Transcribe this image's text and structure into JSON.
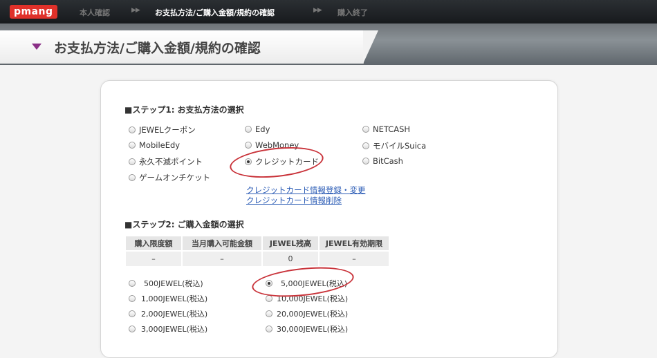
{
  "nav": {
    "logo": "pmang",
    "steps": [
      "本人確認",
      "お支払方法/ご購入金額/規約の確認",
      "購入終了"
    ],
    "arrow": "▶▶"
  },
  "header": {
    "title": "お支払方法/ご購入金額/規約の確認"
  },
  "step1": {
    "title": "■ステップ1: お支払方法の選択",
    "options": [
      {
        "label": "JEWELクーポン",
        "checked": false
      },
      {
        "label": "Edy",
        "checked": false
      },
      {
        "label": "NETCASH",
        "checked": false
      },
      {
        "label": "MobileEdy",
        "checked": false
      },
      {
        "label": "WebMoney",
        "checked": false
      },
      {
        "label": "モバイルSuica",
        "checked": false
      },
      {
        "label": "永久不滅ポイント",
        "checked": false
      },
      {
        "label": "クレジットカード",
        "checked": true
      },
      {
        "label": "BitCash",
        "checked": false
      },
      {
        "label": "ゲームオンチケット",
        "checked": false
      }
    ],
    "links": [
      "クレジットカード情報登録・変更",
      "クレジットカード情報削除"
    ]
  },
  "step2": {
    "title": "■ステップ2: ご購入金額の選択",
    "table": {
      "headers": [
        "購入限度額",
        "当月購入可能金額",
        "JEWEL残高",
        "JEWEL有効期限"
      ],
      "row": [
        "–",
        "–",
        "0",
        "–"
      ]
    },
    "amounts": [
      {
        "label": "500JEWEL(税込)",
        "checked": false
      },
      {
        "label": "5,000JEWEL(税込)",
        "checked": true
      },
      {
        "label": "1,000JEWEL(税込)",
        "checked": false
      },
      {
        "label": "10,000JEWEL(税込)",
        "checked": false
      },
      {
        "label": "2,000JEWEL(税込)",
        "checked": false
      },
      {
        "label": "20,000JEWEL(税込)",
        "checked": false
      },
      {
        "label": "3,000JEWEL(税込)",
        "checked": false
      },
      {
        "label": "30,000JEWEL(税込)",
        "checked": false
      }
    ]
  },
  "colors": {
    "accent": "#8a2f86",
    "logo": "#e0312a",
    "link": "#2a5bb5",
    "annotation": "#c9333a"
  }
}
